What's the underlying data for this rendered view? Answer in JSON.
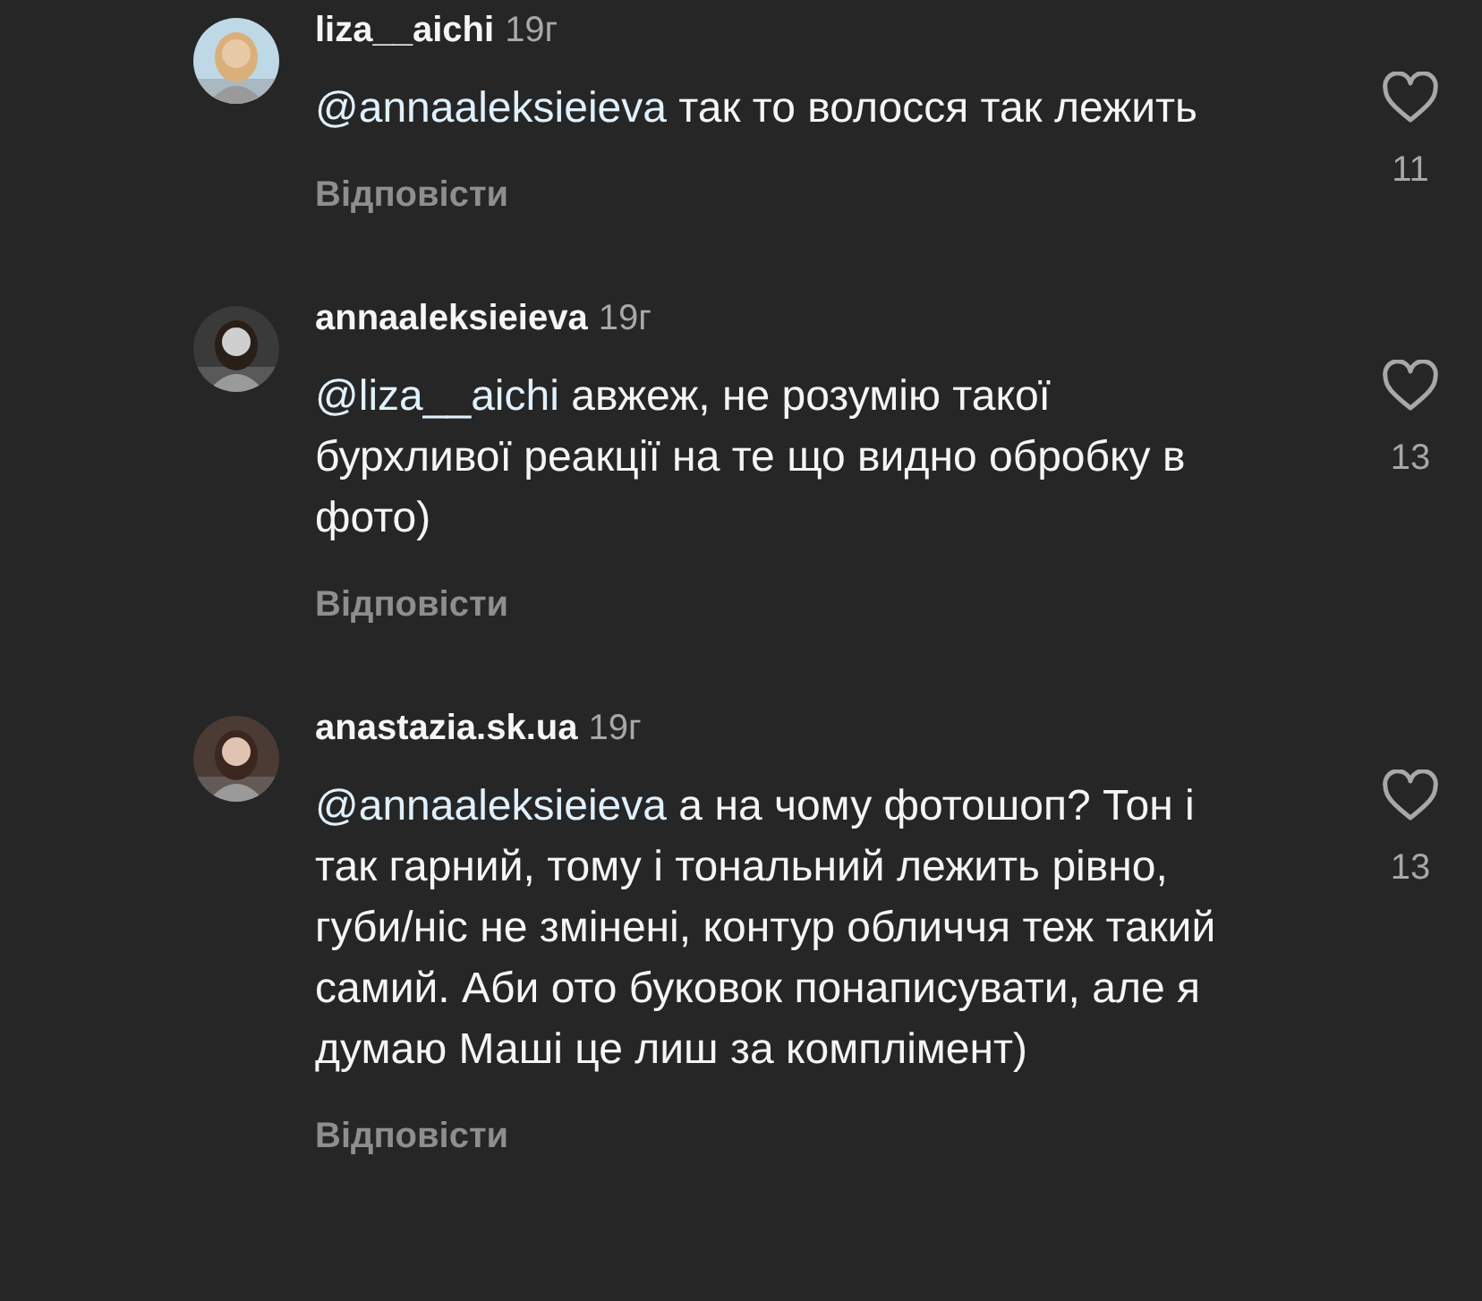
{
  "comments": [
    {
      "username": "liza__aichi",
      "time": "19г",
      "mention": "@annaaleksieieva",
      "text": "так то волосся так лежить",
      "likes": "11",
      "liked": false,
      "reply": "Відповісти"
    },
    {
      "username": "annaaleksieieva",
      "time": "19г",
      "mention": "@liza__aichi",
      "text": "авжеж, не розумію такої бурхливої реакції на те що видно обробку в фото)",
      "likes": "13",
      "liked": false,
      "reply": "Відповісти"
    },
    {
      "username": "anastazia.sk.ua",
      "time": "19г",
      "mention": "@annaaleksieieva",
      "text": "а на чому фотошоп? Тон і так гарний, тому і тональний лежить рівно, губи/ніс не змінені, контур обличчя теж такий самий. Аби ото буковок понаписувати, але я думаю Маші це лиш за комплімент)",
      "likes": "13",
      "liked": false,
      "reply": "Відповісти"
    }
  ]
}
